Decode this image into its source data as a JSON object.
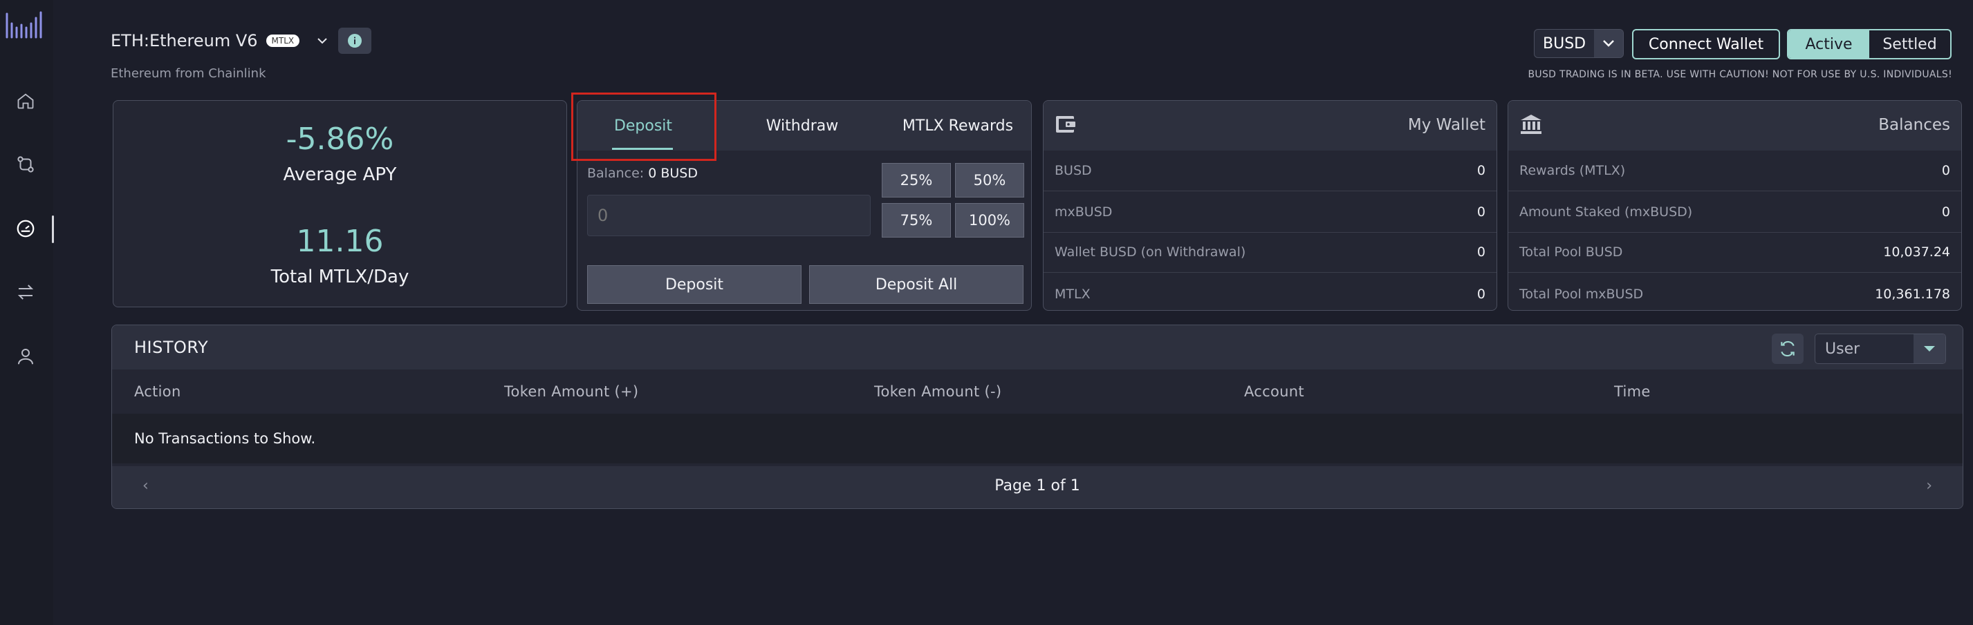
{
  "header": {
    "market_title": "ETH:Ethereum V6",
    "badge": "MTLX",
    "subtitle": "Ethereum from Chainlink",
    "currency": "BUSD",
    "connect_wallet": "Connect Wallet",
    "filter_active": "Active",
    "filter_settled": "Settled",
    "warning": "BUSD TRADING IS IN BETA. USE WITH CAUTION! NOT FOR USE BY U.S. INDIVIDUALS!"
  },
  "stats": {
    "apy_value": "-5.86%",
    "apy_label": "Average APY",
    "mtlx_value": "11.16",
    "mtlx_label": "Total MTLX/Day"
  },
  "deposit_panel": {
    "tabs": [
      "Deposit",
      "Withdraw",
      "MTLX Rewards"
    ],
    "active_tab": "Deposit",
    "balance_label": "Balance:",
    "balance_value": "0 BUSD",
    "amount_placeholder": "0",
    "percent_buttons": [
      "25%",
      "50%",
      "75%",
      "100%"
    ],
    "deposit_button": "Deposit",
    "deposit_all_button": "Deposit All"
  },
  "wallet": {
    "title": "My Wallet",
    "rows": [
      {
        "label": "BUSD",
        "value": "0"
      },
      {
        "label": "mxBUSD",
        "value": "0"
      },
      {
        "label": "Wallet BUSD (on Withdrawal)",
        "value": "0"
      },
      {
        "label": "MTLX",
        "value": "0"
      }
    ]
  },
  "balances": {
    "title": "Balances",
    "rows": [
      {
        "label": "Rewards (MTLX)",
        "value": "0"
      },
      {
        "label": "Amount Staked (mxBUSD)",
        "value": "0"
      },
      {
        "label": "Total Pool BUSD",
        "value": "10,037.24"
      },
      {
        "label": "Total Pool mxBUSD",
        "value": "10,361.178"
      }
    ]
  },
  "history": {
    "title": "HISTORY",
    "filter": "User",
    "columns": [
      "Action",
      "Token Amount (+)",
      "Token Amount (-)",
      "Account",
      "Time"
    ],
    "empty_message": "No Transactions to Show.",
    "pagination": "Page 1 of 1",
    "prev": "‹",
    "next": "›"
  },
  "colors": {
    "accent": "#8fd3cc",
    "background": "#1c1e2a",
    "highlight_box": "#d2261e"
  },
  "icons": {
    "sidebar": [
      "logo-bars-icon",
      "home-icon",
      "swap-nodes-icon",
      "gauge-icon",
      "transfer-arrows-icon",
      "user-icon"
    ],
    "wallet": "wallet-icon",
    "balances": "bank-icon",
    "refresh": "refresh-icon"
  }
}
